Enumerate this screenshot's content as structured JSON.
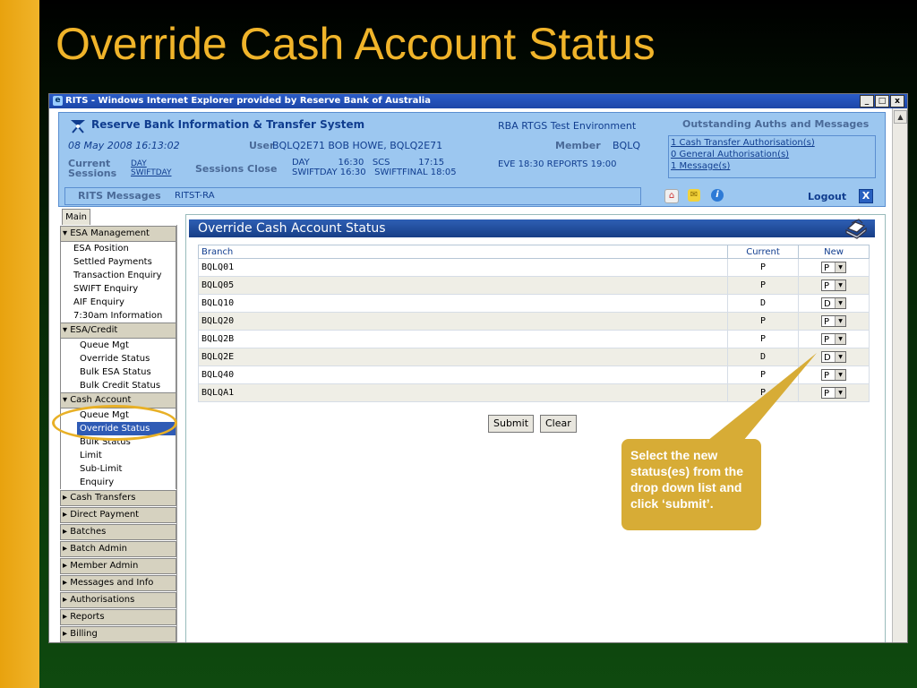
{
  "slide": {
    "title": "Override Cash Account Status",
    "callout": "Select the new status(es) from the drop down list and click ‘submit’."
  },
  "window": {
    "title": "RITS - Windows Internet Explorer provided by Reserve Bank of Australia",
    "buttons": [
      "_",
      "□",
      "x"
    ]
  },
  "header": {
    "system_name": "Reserve Bank Information & Transfer System",
    "environment": "RBA RTGS Test Environment",
    "outstanding_title": "Outstanding Auths and Messages",
    "datetime": "08 May 2008 16:13:02",
    "user_label": "User",
    "user_value": "BQLQ2E71 BOB HOWE, BQLQ2E71",
    "member_label": "Member",
    "member_value": "BQLQ",
    "current_sessions_label_1": "Current",
    "current_sessions_label_2": "Sessions",
    "current_session_1": "DAY",
    "current_session_2": "SWIFTDAY",
    "sessions_close_label": "Sessions Close",
    "close_row_1": "DAY          16:30   SCS          17:15",
    "close_row_2": "SWIFTDAY 16:30   SWIFTFINAL 18:05",
    "eve_text": "EVE 18:30 REPORTS 19:00",
    "auth_links": [
      "1 Cash Transfer Authorisation(s)",
      "0 General Authorisation(s)",
      "1 Message(s)"
    ],
    "rits_messages_label": "RITS Messages",
    "rits_messages_value": "RITST-RA",
    "logout_label": "Logout"
  },
  "sidebar": {
    "main_tab": "Main",
    "esa_management": {
      "label": "ESA Management",
      "items": [
        "ESA Position",
        "Settled Payments",
        "Transaction Enquiry",
        "SWIFT Enquiry",
        "AIF Enquiry",
        "7:30am Information"
      ]
    },
    "esa_credit": {
      "label": "ESA/Credit",
      "items": [
        "Queue Mgt",
        "Override Status",
        "Bulk ESA Status",
        "Bulk Credit Status"
      ]
    },
    "cash_account": {
      "label": "Cash Account",
      "items": [
        "Queue Mgt",
        "Override Status",
        "Bulk Status",
        "Limit",
        "Sub-Limit",
        "Enquiry"
      ]
    },
    "collapsed": [
      "Cash Transfers",
      "Direct Payment",
      "Batches",
      "Batch Admin",
      "Member Admin",
      "Messages and Info",
      "Authorisations",
      "Reports",
      "Billing"
    ]
  },
  "panel": {
    "title": "Override Cash Account Status",
    "columns": [
      "Branch",
      "Current",
      "New"
    ],
    "rows": [
      {
        "branch": "BQLQ01",
        "current": "P",
        "new": "P"
      },
      {
        "branch": "BQLQ05",
        "current": "P",
        "new": "P"
      },
      {
        "branch": "BQLQ10",
        "current": "D",
        "new": "D"
      },
      {
        "branch": "BQLQ20",
        "current": "P",
        "new": "P"
      },
      {
        "branch": "BQLQ2B",
        "current": "P",
        "new": "P"
      },
      {
        "branch": "BQLQ2E",
        "current": "D",
        "new": "D"
      },
      {
        "branch": "BQLQ40",
        "current": "P",
        "new": "P"
      },
      {
        "branch": "BQLQA1",
        "current": "P",
        "new": "P"
      }
    ],
    "submit_label": "Submit",
    "clear_label": "Clear"
  },
  "colors": {
    "slide_title": "#f0b42a",
    "left_bar": "#e8a20e",
    "header_bg": "#9cc7f0",
    "selected_item": "#2f5bb5",
    "callout": "#d7ac36"
  }
}
